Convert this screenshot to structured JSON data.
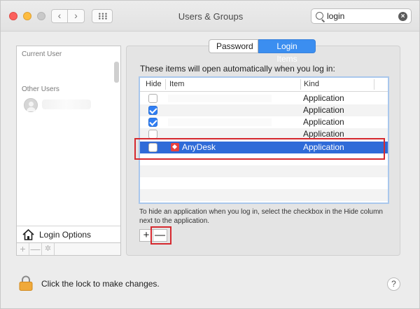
{
  "window": {
    "title": "Users & Groups",
    "nav_back": "‹",
    "nav_forward": "›"
  },
  "search": {
    "value": "login",
    "clear_symbol": "×"
  },
  "sidebar": {
    "current_user_heading": "Current User",
    "other_users_heading": "Other Users",
    "login_options_label": "Login Options",
    "tools": {
      "add": "+",
      "remove": "—",
      "gear": "✲"
    }
  },
  "tabs": [
    {
      "label": "Password",
      "selected": false
    },
    {
      "label": "Login Items",
      "selected": true
    }
  ],
  "login_items": {
    "intro": "These items will open automatically when you log in:",
    "columns": {
      "hide": "Hide",
      "item": "Item",
      "kind": "Kind"
    },
    "rows": [
      {
        "hide": false,
        "name": "",
        "kind": "Application"
      },
      {
        "hide": true,
        "name": "",
        "kind": "Application"
      },
      {
        "hide": true,
        "name": "",
        "kind": "Application"
      },
      {
        "hide": false,
        "name": "",
        "kind": "Application"
      },
      {
        "hide": false,
        "name": "AnyDesk",
        "kind": "Application",
        "selected": true
      }
    ],
    "hint": "To hide an application when you log in, select the checkbox in the Hide column next to the application.",
    "add_symbol": "+",
    "remove_symbol": "—"
  },
  "footer": {
    "lock_text": "Click the lock to make changes.",
    "help_symbol": "?"
  },
  "colors": {
    "selection": "#2f6bd8",
    "highlight_box": "#d6292f",
    "tab_selected": "#3b8ef0",
    "anydesk_icon": "#e8413e"
  }
}
